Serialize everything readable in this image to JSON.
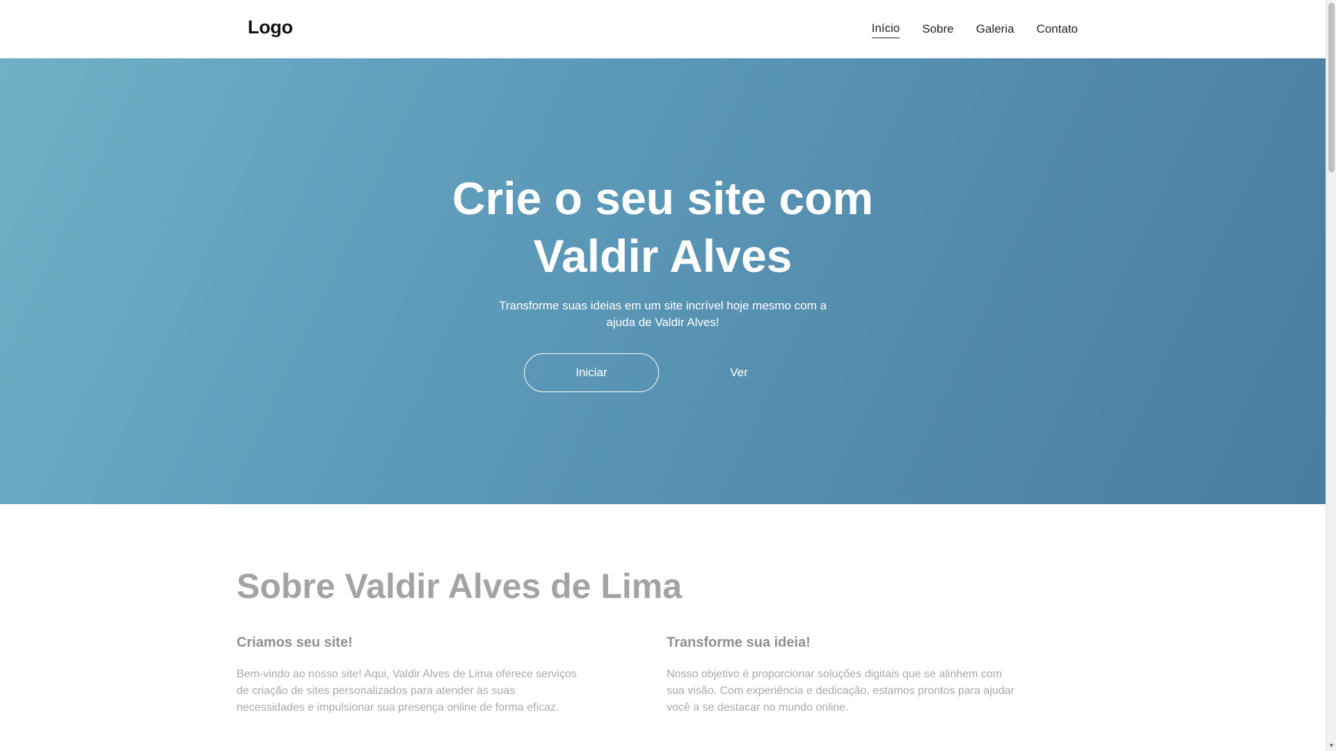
{
  "header": {
    "logo": "Logo",
    "nav": [
      {
        "label": "Início",
        "active": true
      },
      {
        "label": "Sobre",
        "active": false
      },
      {
        "label": "Galeria",
        "active": false
      },
      {
        "label": "Contato",
        "active": false
      }
    ]
  },
  "hero": {
    "title": "Crie o seu site com Valdir Alves",
    "subtitle": "Transforme suas ideias em um site incrível hoje mesmo com a ajuda de Valdir Alves!",
    "primary_button": "Iniciar",
    "secondary_button": "Ver",
    "gradient": [
      "#6fb1c6",
      "#4a7d9f"
    ]
  },
  "about": {
    "title": "Sobre Valdir Alves de Lima",
    "columns": [
      {
        "heading": "Criamos seu site!",
        "text": "Bem-vindo ao nosso site! Aqui, Valdir Alves de Lima oferece serviços de criação de sites personalizados para atender às suas necessidades e impulsionar sua presença online de forma eficaz."
      },
      {
        "heading": "Transforme sua ideia!",
        "text": "Nosso objetivo é proporcionar soluções digitais que se alinhem com sua visão. Com experiência e dedicação, estamos prontos para ajudar você a se destacar no mundo online."
      }
    ]
  },
  "scrollbar": {
    "down_arrow_icon": "chevron-down-icon"
  }
}
